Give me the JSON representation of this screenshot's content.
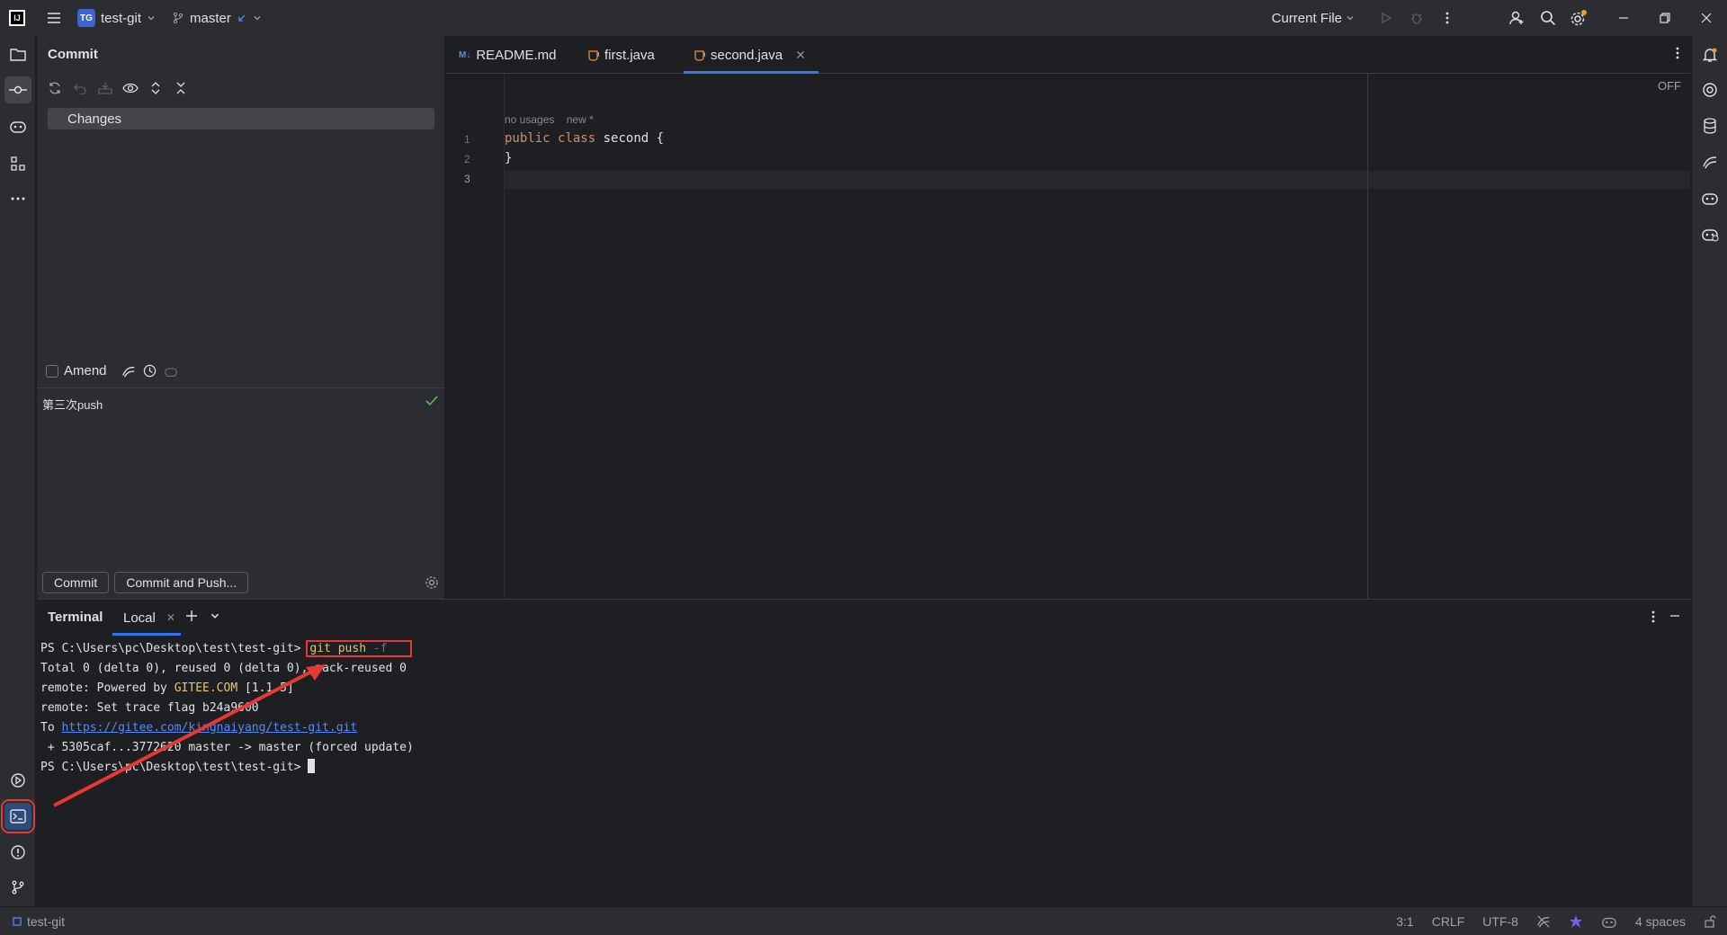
{
  "titlebar": {
    "project_badge": "TG",
    "project_name": "test-git",
    "branch": "master",
    "run_config": "Current File"
  },
  "commit_panel": {
    "title": "Commit",
    "changes_label": "Changes",
    "amend_label": "Amend",
    "message": "第三次push",
    "commit_button": "Commit",
    "commit_push_button": "Commit and Push..."
  },
  "editor": {
    "tabs": [
      {
        "label": "README.md",
        "icon": "markdown-icon",
        "active": false
      },
      {
        "label": "first.java",
        "icon": "java-file-icon",
        "active": false
      },
      {
        "label": "second.java",
        "icon": "java-file-icon",
        "active": true
      }
    ],
    "inlay_usages": "no usages",
    "inlay_new": "new *",
    "line_numbers": [
      "1",
      "2",
      "3"
    ],
    "code": {
      "kw1": "public",
      "kw2": "class",
      "rest1": " second {",
      "line2": "}"
    },
    "off_label": "OFF"
  },
  "terminal": {
    "title": "Terminal",
    "tab_label": "Local",
    "prompt": "PS C:\\Users\\pc\\Desktop\\test\\test-git>",
    "command": "git push",
    "command_flag": " -f",
    "line2": "Total 0 (delta 0), reused 0 (delta 0), pack-reused 0",
    "line3_pre": "remote: Powered by ",
    "line3_hl": "GITEE.COM",
    "line3_post": " [1.1.5]",
    "line4": "remote: Set trace flag b24a9600",
    "line5_pre": "To ",
    "line5_link": "https://gitee.com/kingnaiyang/test-git.git",
    "line6": " + 5305caf...3772620 master -> master (forced update)",
    "prompt2": "PS C:\\Users\\pc\\Desktop\\test\\test-git>"
  },
  "statusbar": {
    "project": "test-git",
    "position": "3:1",
    "line_sep": "CRLF",
    "encoding": "UTF-8",
    "indent": "4 spaces"
  },
  "colors": {
    "accent": "#3574f0",
    "annotation_red": "#e53935",
    "keyword": "#cf8e6d"
  }
}
